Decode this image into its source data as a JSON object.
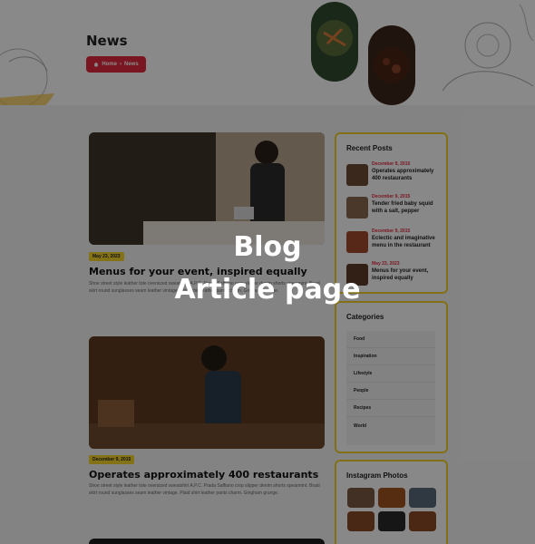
{
  "header": {
    "title": "News",
    "breadcrumb": {
      "home": "Home",
      "current": "News"
    }
  },
  "articles": [
    {
      "date": "May 23, 2023",
      "title": "Menus for your event, inspired equally",
      "excerpt": "Shoe street style leather tote oversized sweatshirt A.P.C. Prada Saffiano crop slipper denim shorts spearmint. Braid skirt round sunglasses seam leather vintage. Plaid shirt leather pants charm. Gingham grunge."
    },
    {
      "date": "December 9, 2015",
      "title": "Operates approximately 400 restaurants",
      "excerpt": "Shoe street style leather tote oversized sweatshirt A.P.C. Prada Saffiano crop slipper denim shorts spearmint. Braid skirt round sunglasses seam leather vintage. Plaid shirt leather pants charm. Gingham grunge."
    }
  ],
  "sidebar": {
    "recent": {
      "title": "Recent Posts",
      "posts": [
        {
          "date": "December 9, 2015",
          "title": "Operates approximately 400 restaurants"
        },
        {
          "date": "December 9, 2015",
          "title": "Tender fried baby squid with a salt, pepper"
        },
        {
          "date": "December 9, 2015",
          "title": "Eclectic and imaginative menu in the restaurant"
        },
        {
          "date": "May 23, 2023",
          "title": "Menus for your event, inspired equally"
        }
      ]
    },
    "categories": {
      "title": "Categories",
      "items": [
        "Food",
        "Inspiration",
        "Lifestyle",
        "People",
        "Recipes",
        "World"
      ]
    },
    "instagram": {
      "title": "Instagram Photos"
    }
  },
  "overlay": {
    "line1": "Blog",
    "line2": "Article page"
  },
  "colors": {
    "accent_red": "#e02a3e",
    "accent_yellow": "#f0cf2a"
  }
}
